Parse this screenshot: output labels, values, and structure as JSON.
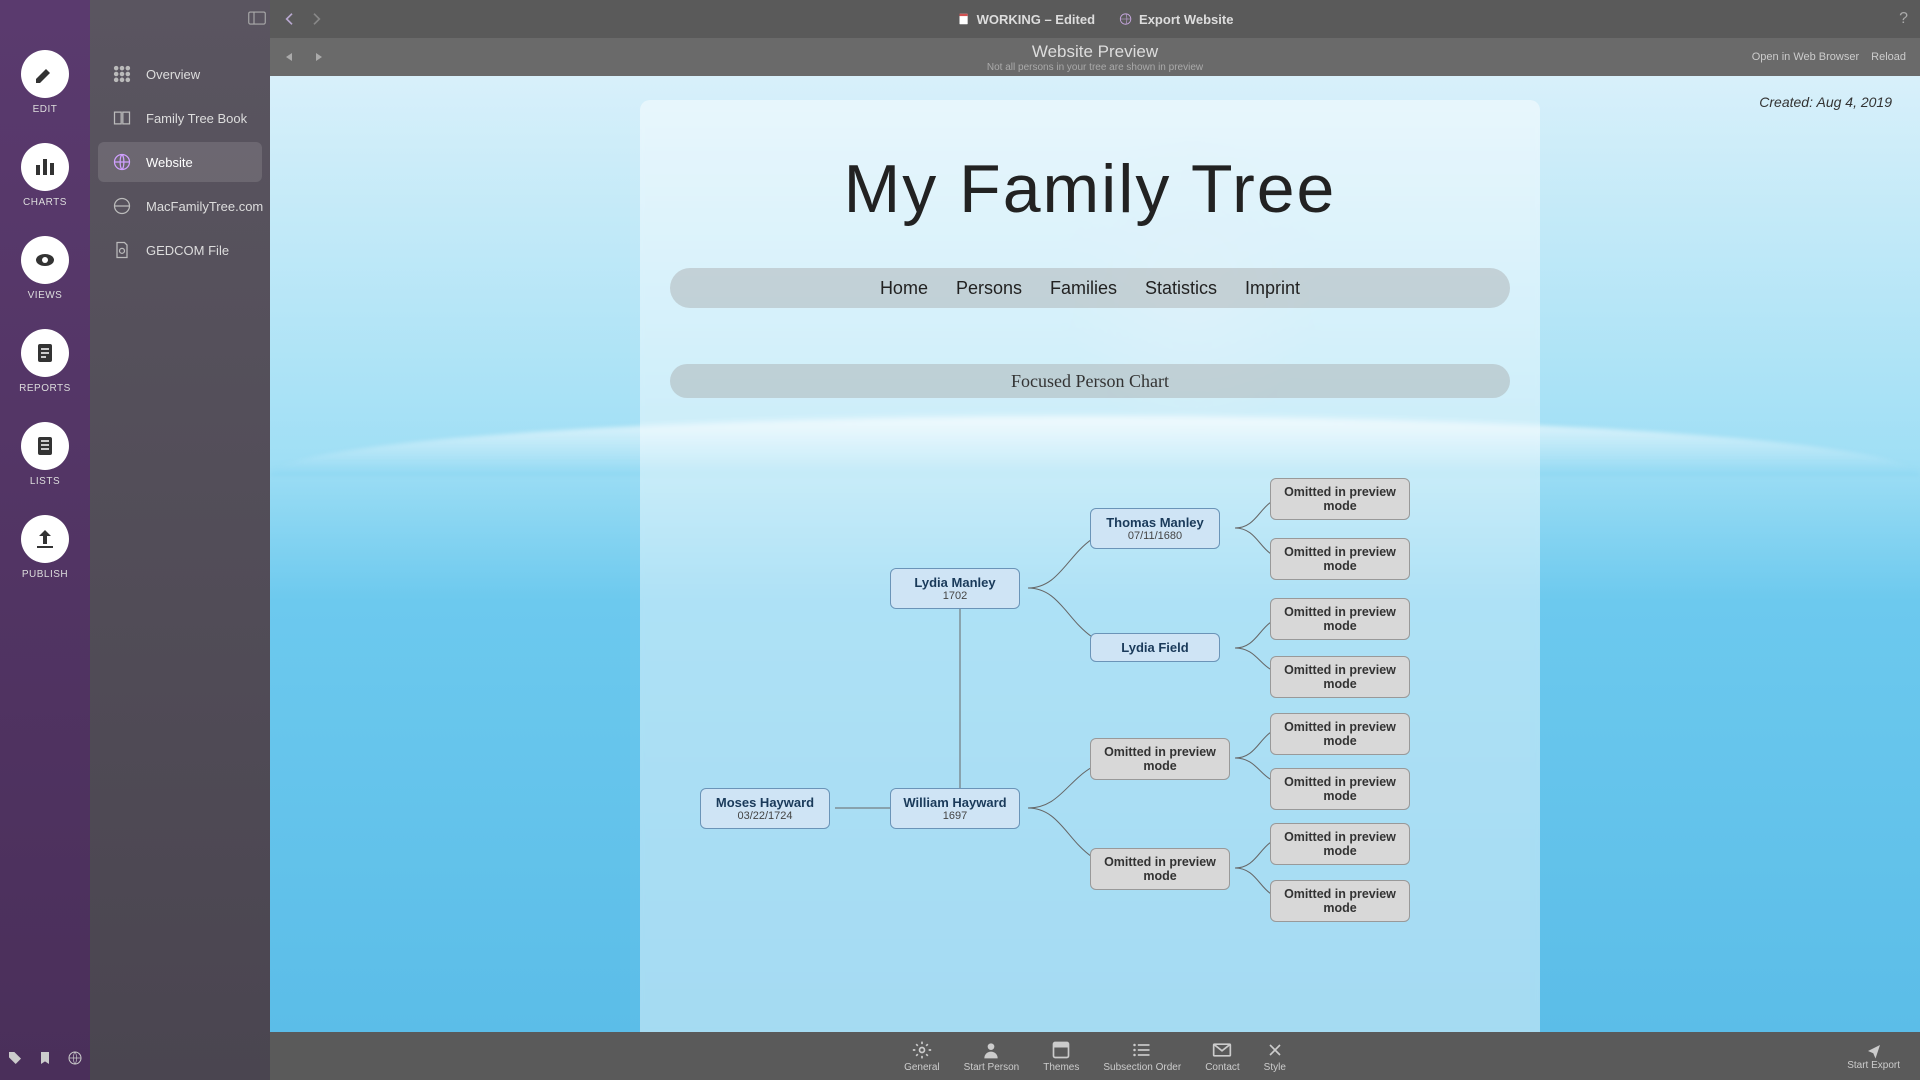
{
  "rail": {
    "items": [
      {
        "label": "EDIT"
      },
      {
        "label": "CHARTS"
      },
      {
        "label": "VIEWS"
      },
      {
        "label": "REPORTS"
      },
      {
        "label": "LISTS"
      },
      {
        "label": "PUBLISH"
      }
    ]
  },
  "sidebar": {
    "items": [
      {
        "label": "Overview"
      },
      {
        "label": "Family Tree Book"
      },
      {
        "label": "Website"
      },
      {
        "label": "MacFamilyTree.com"
      },
      {
        "label": "GEDCOM File"
      }
    ]
  },
  "topbar": {
    "doc_name": "WORKING – Edited",
    "export_label": "Export Website",
    "help": "?"
  },
  "subbar": {
    "title": "Website Preview",
    "subtitle": "Not all persons in your tree are shown in preview",
    "open_browser": "Open in Web Browser",
    "reload": "Reload"
  },
  "preview": {
    "created_label": "Created:",
    "created_date": "Aug 4, 2019",
    "site_title": "My Family Tree",
    "nav": [
      "Home",
      "Persons",
      "Families",
      "Statistics",
      "Imprint"
    ],
    "chart_title": "Focused Person Chart",
    "nodes": {
      "moses": {
        "name": "Moses Hayward",
        "date": "03/22/1724"
      },
      "william": {
        "name": "William Hayward",
        "date": "1697"
      },
      "lydia_m": {
        "name": "Lydia Manley",
        "date": "1702"
      },
      "thomas": {
        "name": "Thomas Manley",
        "date": "07/11/1680"
      },
      "lydia_f": {
        "name": "Lydia Field",
        "date": ""
      },
      "omitted": "Omitted in preview mode"
    }
  },
  "bottombar": {
    "items": [
      "General",
      "Start Person",
      "Themes",
      "Subsection Order",
      "Contact",
      "Style"
    ],
    "start_export": "Start Export"
  }
}
